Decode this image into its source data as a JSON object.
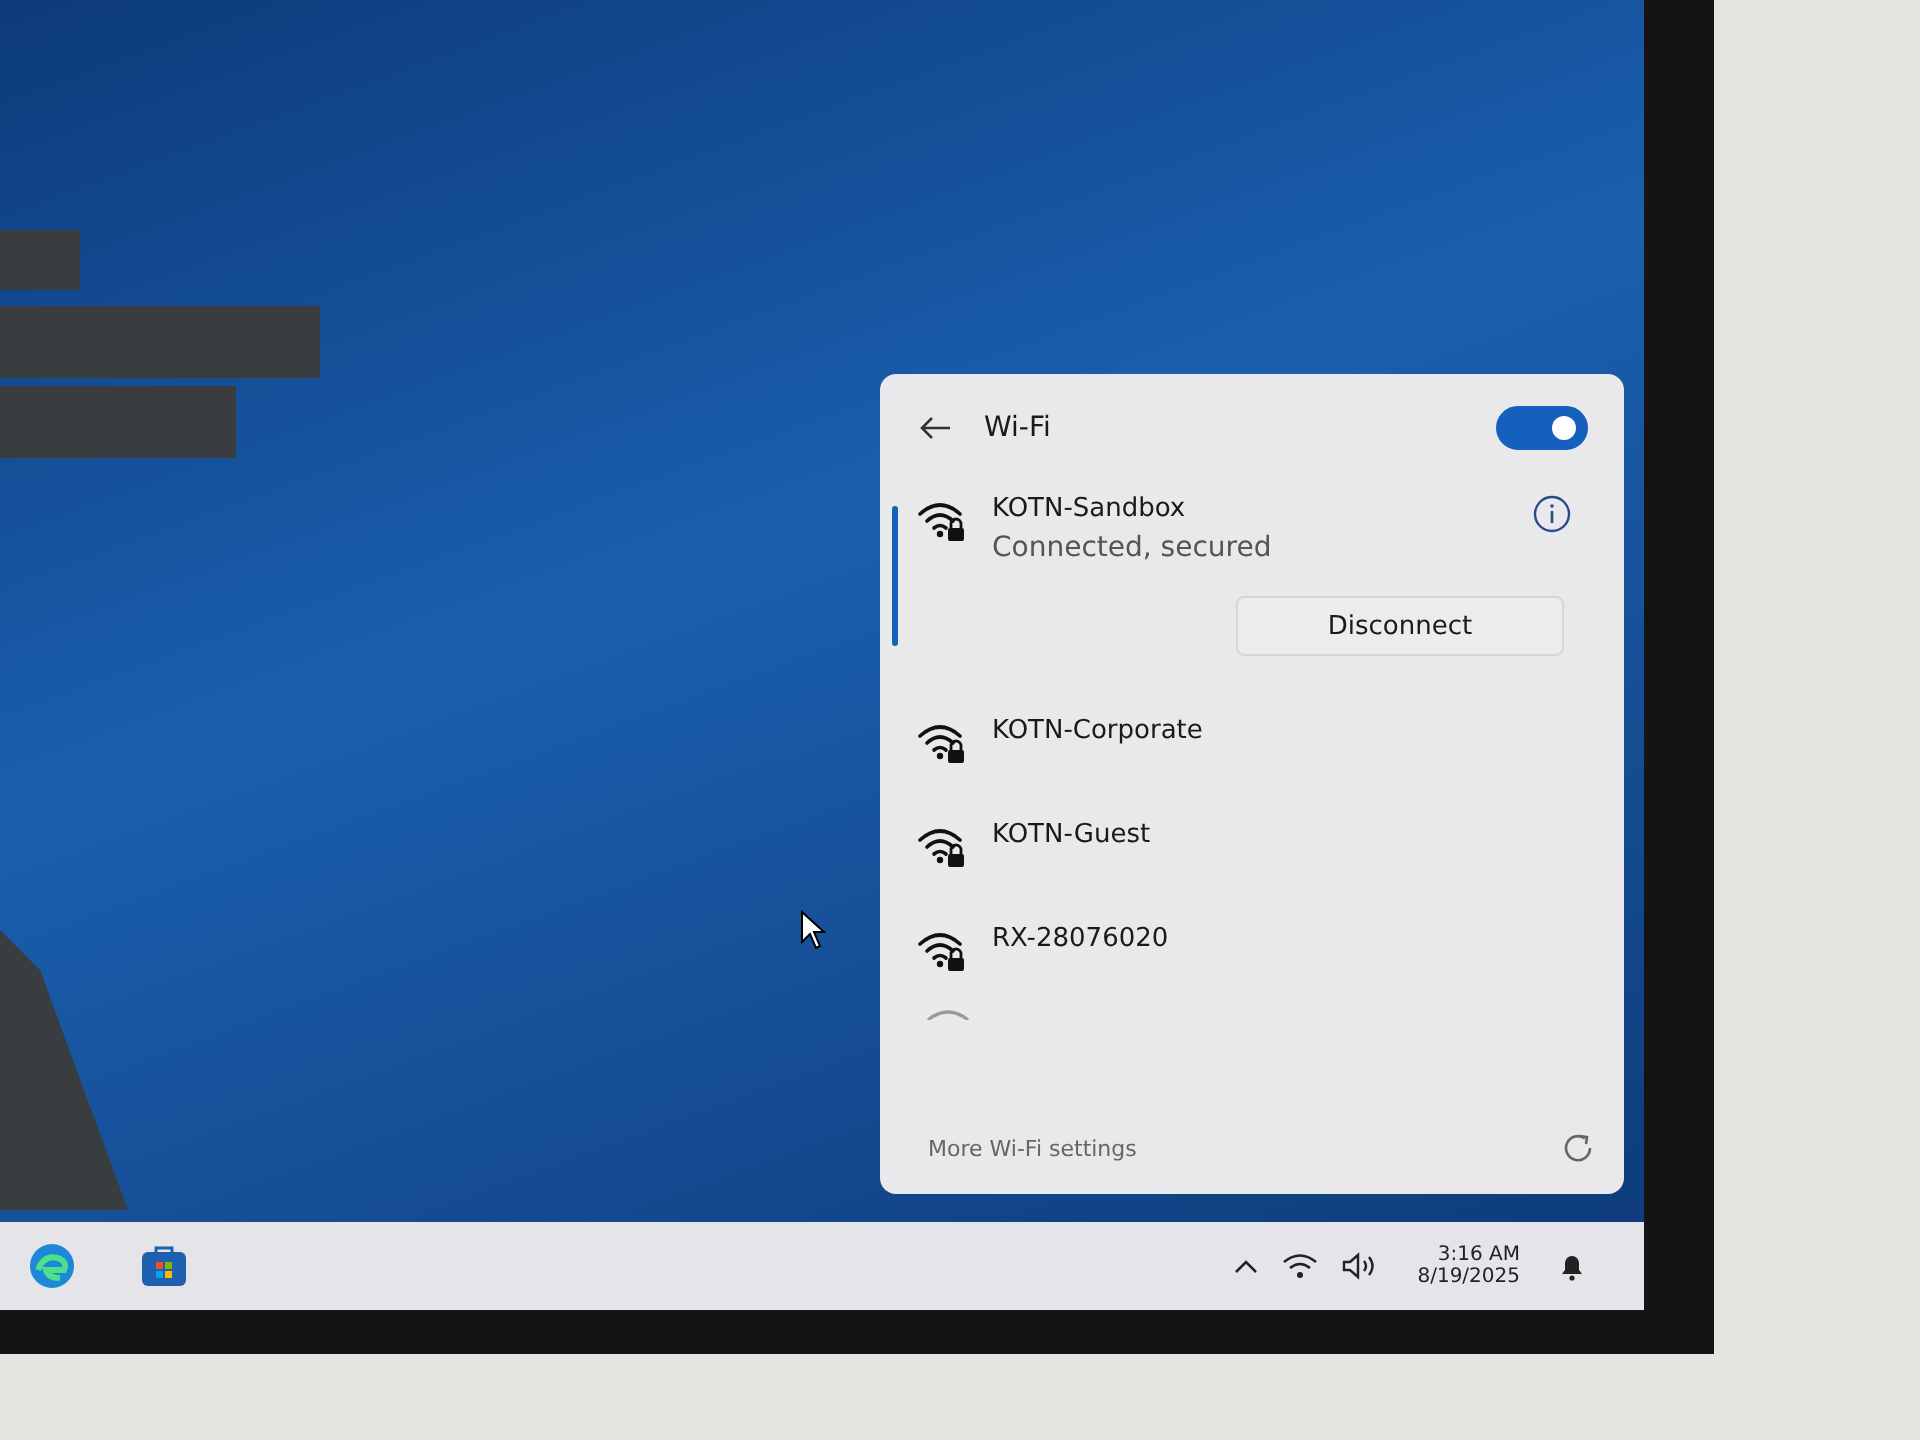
{
  "flyout": {
    "title": "Wi-Fi",
    "wifi_on": true,
    "networks": [
      {
        "name": "KOTN-Sandbox",
        "secured": true,
        "selected": true,
        "status": "Connected, secured",
        "action": "Disconnect"
      },
      {
        "name": "KOTN-Corporate",
        "secured": true,
        "selected": false
      },
      {
        "name": "KOTN-Guest",
        "secured": true,
        "selected": false
      },
      {
        "name": "RX-28076020",
        "secured": true,
        "selected": false
      }
    ],
    "footer_link": "More Wi-Fi settings"
  },
  "taskbar": {
    "time": "3:16 AM",
    "date": "8/19/2025"
  }
}
